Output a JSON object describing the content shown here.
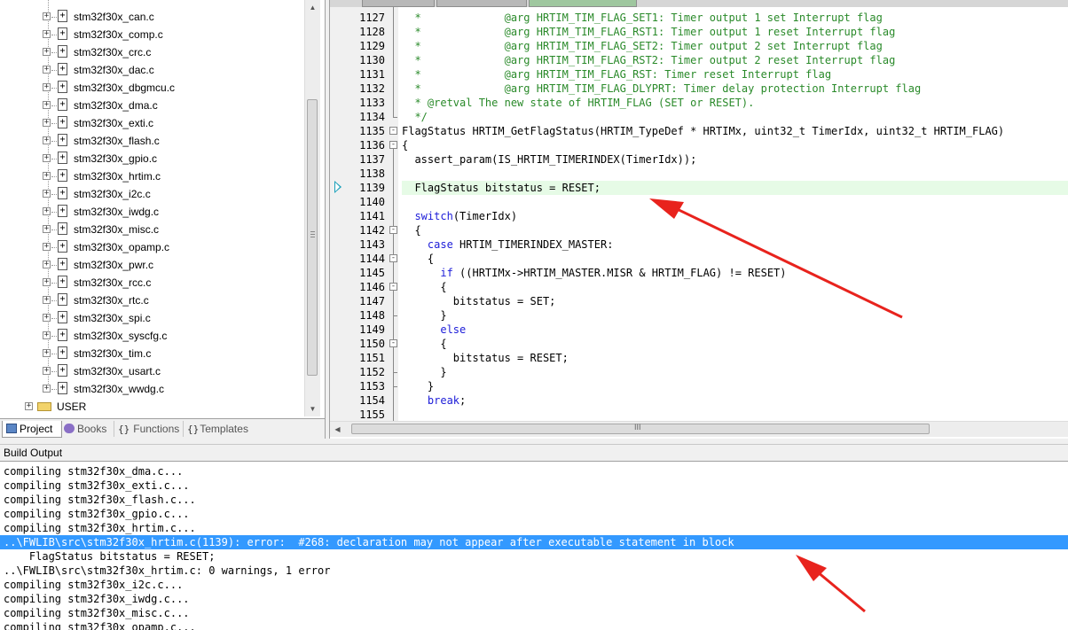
{
  "project_tree": {
    "files": [
      "stm32f30x_can.c",
      "stm32f30x_comp.c",
      "stm32f30x_crc.c",
      "stm32f30x_dac.c",
      "stm32f30x_dbgmcu.c",
      "stm32f30x_dma.c",
      "stm32f30x_exti.c",
      "stm32f30x_flash.c",
      "stm32f30x_gpio.c",
      "stm32f30x_hrtim.c",
      "stm32f30x_i2c.c",
      "stm32f30x_iwdg.c",
      "stm32f30x_misc.c",
      "stm32f30x_opamp.c",
      "stm32f30x_pwr.c",
      "stm32f30x_rcc.c",
      "stm32f30x_rtc.c",
      "stm32f30x_spi.c",
      "stm32f30x_syscfg.c",
      "stm32f30x_tim.c",
      "stm32f30x_usart.c",
      "stm32f30x_wwdg.c"
    ],
    "folder": "USER",
    "expander_symbol": "+",
    "file_glyph": "+"
  },
  "panel_tabs": [
    {
      "label": "Project",
      "icon": "project-icon"
    },
    {
      "label": "Books",
      "icon": "books-icon"
    },
    {
      "label": "Functions",
      "icon": "functions-icon",
      "prefix": "{}"
    },
    {
      "label": "Templates",
      "icon": "templates-icon",
      "prefix": "{}"
    }
  ],
  "editor": {
    "lines": [
      {
        "no": "1127",
        "kind": "comment",
        "text": "  *             @arg HRTIM_TIM_FLAG_SET1: Timer output 1 set Interrupt flag"
      },
      {
        "no": "1128",
        "kind": "comment",
        "text": "  *             @arg HRTIM_TIM_FLAG_RST1: Timer output 1 reset Interrupt flag"
      },
      {
        "no": "1129",
        "kind": "comment",
        "text": "  *             @arg HRTIM_TIM_FLAG_SET2: Timer output 2 set Interrupt flag"
      },
      {
        "no": "1130",
        "kind": "comment",
        "text": "  *             @arg HRTIM_TIM_FLAG_RST2: Timer output 2 reset Interrupt flag"
      },
      {
        "no": "1131",
        "kind": "comment",
        "text": "  *             @arg HRTIM_TIM_FLAG_RST: Timer reset Interrupt flag"
      },
      {
        "no": "1132",
        "kind": "comment",
        "text": "  *             @arg HRTIM_TIM_FLAG_DLYPRT: Timer delay protection Interrupt flag"
      },
      {
        "no": "1133",
        "kind": "comment",
        "text": "  * @retval The new state of HRTIM_FLAG (SET or RESET)."
      },
      {
        "no": "1134",
        "kind": "comment",
        "text": "  */"
      },
      {
        "no": "1135",
        "kind": "plain",
        "text": "FlagStatus HRTIM_GetFlagStatus(HRTIM_TypeDef * HRTIMx, uint32_t TimerIdx, uint32_t HRTIM_FLAG)"
      },
      {
        "no": "1136",
        "kind": "plain",
        "text": "{"
      },
      {
        "no": "1137",
        "kind": "plain",
        "text": "  assert_param(IS_HRTIM_TIMERINDEX(TimerIdx));"
      },
      {
        "no": "1138",
        "kind": "plain",
        "text": ""
      },
      {
        "no": "1139",
        "kind": "plain",
        "text": "  FlagStatus bitstatus = RESET;"
      },
      {
        "no": "1140",
        "kind": "plain",
        "text": ""
      },
      {
        "no": "1141",
        "kind": "keyword",
        "keyword": "switch",
        "pre": "  ",
        "post": "(TimerIdx)"
      },
      {
        "no": "1142",
        "kind": "plain",
        "text": "  {"
      },
      {
        "no": "1143",
        "kind": "keyword",
        "keyword": "case",
        "pre": "    ",
        "post": " HRTIM_TIMERINDEX_MASTER:"
      },
      {
        "no": "1144",
        "kind": "plain",
        "text": "    {"
      },
      {
        "no": "1145",
        "kind": "keyword",
        "keyword": "if",
        "pre": "      ",
        "post": " ((HRTIMx->HRTIM_MASTER.MISR & HRTIM_FLAG) != RESET)"
      },
      {
        "no": "1146",
        "kind": "plain",
        "text": "      {"
      },
      {
        "no": "1147",
        "kind": "plain",
        "text": "        bitstatus = SET;"
      },
      {
        "no": "1148",
        "kind": "plain",
        "text": "      }"
      },
      {
        "no": "1149",
        "kind": "keyword",
        "keyword": "else",
        "pre": "      ",
        "post": ""
      },
      {
        "no": "1150",
        "kind": "plain",
        "text": "      {"
      },
      {
        "no": "1151",
        "kind": "plain",
        "text": "        bitstatus = RESET;"
      },
      {
        "no": "1152",
        "kind": "plain",
        "text": "      }"
      },
      {
        "no": "1153",
        "kind": "plain",
        "text": "    }"
      },
      {
        "no": "1154",
        "kind": "keyword",
        "keyword": "break",
        "pre": "    ",
        "post": ";"
      },
      {
        "no": "1155",
        "kind": "plain",
        "text": ""
      }
    ],
    "current_line": "1139",
    "fold_markers": [
      "1135",
      "1136",
      "1142",
      "1144",
      "1146",
      "1150"
    ],
    "fold_symbol": "-",
    "hscroll_grip": "III"
  },
  "build_output": {
    "title": "Build Output",
    "lines": [
      "compiling stm32f30x_dma.c...",
      "compiling stm32f30x_exti.c...",
      "compiling stm32f30x_flash.c...",
      "compiling stm32f30x_gpio.c...",
      "compiling stm32f30x_hrtim.c...",
      "..\\FWLIB\\src\\stm32f30x_hrtim.c(1139): error:  #268: declaration may not appear after executable statement in block",
      "    FlagStatus bitstatus = RESET;",
      "..\\FWLIB\\src\\stm32f30x_hrtim.c: 0 warnings, 1 error",
      "compiling stm32f30x_i2c.c...",
      "compiling stm32f30x_iwdg.c...",
      "compiling stm32f30x_misc.c...",
      "compiling stm32f30x_opamp.c..."
    ],
    "selected_index": 5
  },
  "colors": {
    "comment": "#2a8a2a",
    "keyword": "#1c1cd8",
    "selection": "#3399ff",
    "current_line": "#e6fbe6",
    "annotation_arrow": "#e8231d",
    "current_line_marker": "#1aa0ba"
  }
}
